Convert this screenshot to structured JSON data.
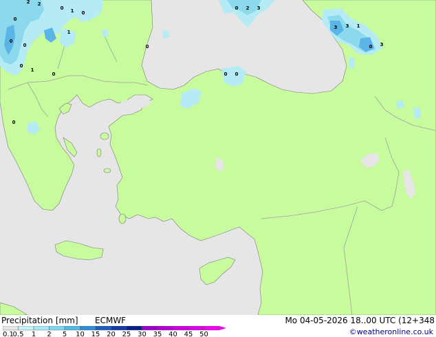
{
  "map": {
    "colors": {
      "sea": "#e6e6e6",
      "land": "#c8fa9e",
      "coast": "#7a7a7a",
      "border": "#a0a0a0",
      "precip_light": "#b4ebf5",
      "precip_mid": "#8cd9ee",
      "precip_heavy": "#5ab4e6"
    },
    "precip_labels": [
      "2",
      "2",
      "0",
      "1",
      "0",
      "0",
      "1",
      "0",
      "0",
      "0",
      "1",
      "0",
      "0",
      "2",
      "3",
      "3",
      "3",
      "1",
      "0",
      "3",
      "0",
      "0",
      "0",
      "0"
    ]
  },
  "footer": {
    "title": "Precipitation [mm]",
    "model": "ECMWF",
    "datetime": "Mo 04-05-2026 18..00 UTC (12+348",
    "credit": "©weatheronline.co.uk",
    "scale": {
      "ticks": [
        "0.1",
        "0.5",
        "1",
        "2",
        "5",
        "10",
        "15",
        "20",
        "25",
        "30",
        "35",
        "40",
        "45",
        "50"
      ],
      "colors": [
        "#e6e6e6",
        "#c8f0f8",
        "#a6e6f5",
        "#80d6f0",
        "#55b8e6",
        "#2f8fd6",
        "#1e5fbf",
        "#163aa8",
        "#0a1e8a",
        "#9c00c8",
        "#b400d2",
        "#c800dc",
        "#dc00e6",
        "#f000f0"
      ]
    }
  }
}
